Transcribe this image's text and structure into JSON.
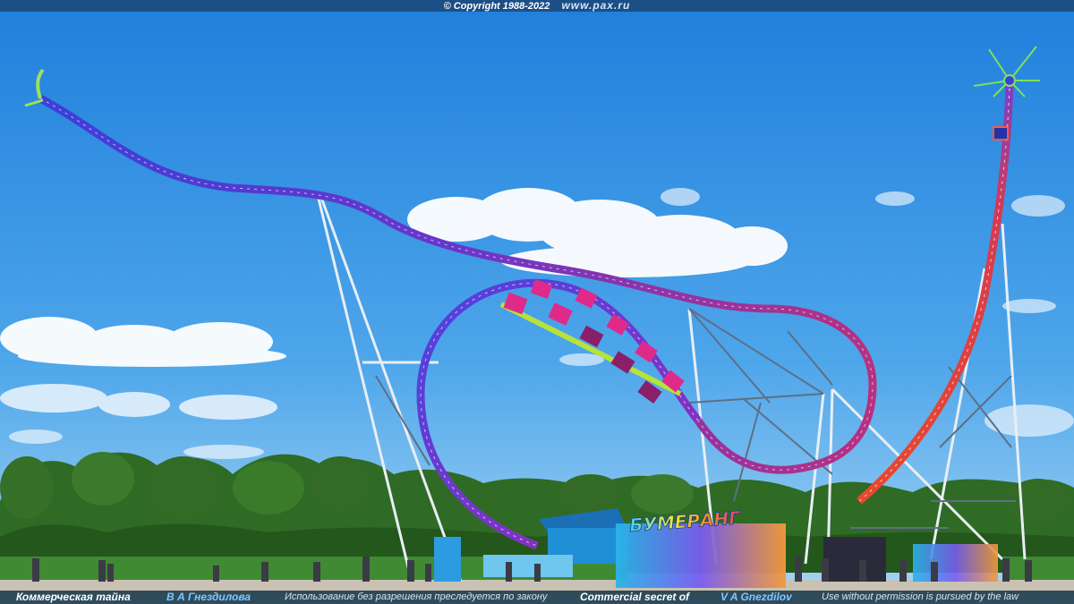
{
  "header": {
    "copyright": "© Copyright 1988-2022",
    "site": "www.pax.ru"
  },
  "sign": {
    "text": "БУМЕРАНГ"
  },
  "footer": {
    "ru_label": "Коммерческая тайна",
    "ru_author": "В А Гнездилова",
    "ru_notice": "Использование без разрешения преследуется по закону",
    "en_label": "Commercial secret of",
    "en_author": "V A Gnezdilov",
    "en_notice": "Use without permission is pursued by the law"
  },
  "colors": {
    "sky_top": "#1f7fdc",
    "sky_bottom": "#9fd1f5",
    "track_blue": "#3b3fd6",
    "track_purple": "#8a2fbf",
    "track_red": "#e0432a",
    "foliage": "#2f6b25",
    "footer_bg": "#142d3c",
    "footer_accent": "#7fc6ff"
  },
  "icons": {
    "spire": "star-burst-icon"
  }
}
